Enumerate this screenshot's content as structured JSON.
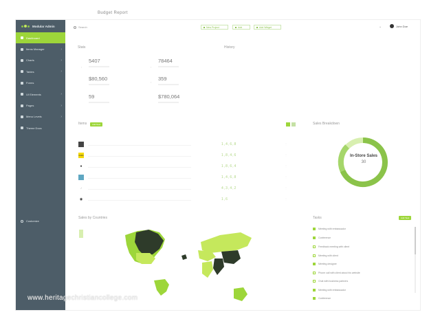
{
  "page": {
    "title": "Modular Admin"
  },
  "header": {
    "top_title": "Budget Report",
    "search_placeholder": "Search",
    "buttons": [
      "New Project",
      "Add",
      "Add Widget"
    ],
    "user_name": "John Doe"
  },
  "sidebar": {
    "brand": "Modular Admin",
    "items": [
      {
        "label": "Dashboard"
      },
      {
        "label": "Items Manager"
      },
      {
        "label": "Charts"
      },
      {
        "label": "Tables"
      },
      {
        "label": "Forms"
      },
      {
        "label": "UI Elements"
      },
      {
        "label": "Pages"
      },
      {
        "label": "Menu Levels"
      },
      {
        "label": "Theme Docs"
      }
    ],
    "footer": "Customize"
  },
  "stats": {
    "title": "Stats",
    "side_title": "History",
    "values": [
      "5407",
      "78464",
      "$80,560",
      "359",
      "59",
      "$780,064"
    ]
  },
  "items": {
    "title": "Items",
    "badge": "Add New",
    "rows": [
      {
        "value": "1,4,6,8"
      },
      {
        "value": "1,8,4,6"
      },
      {
        "value": "1,8,6,4"
      },
      {
        "value": "1,4,6,8"
      },
      {
        "value": "4,3,4,2"
      },
      {
        "value": "1,6"
      }
    ]
  },
  "sales": {
    "title": "Sales Breakdown",
    "center_label": "In-Store Sales",
    "center_value": "30"
  },
  "map": {
    "title": "Sales by Countries"
  },
  "tasks": {
    "title": "Tasks",
    "badge": "Add Task",
    "items": [
      {
        "label": "Meeting with embassador"
      },
      {
        "label": "Conference"
      },
      {
        "label": "Feedback meeting with client"
      },
      {
        "label": "Meeting with client"
      },
      {
        "label": "Meeting designer"
      },
      {
        "label": "Phone call with client about his website"
      },
      {
        "label": "Chat with business partners"
      },
      {
        "label": "Meeting with embassador"
      },
      {
        "label": "Conference"
      }
    ]
  },
  "watermark": "www.heritagechristiancollege.com",
  "colors": {
    "accent": "#9dd63a",
    "sidebar": "#4d5d68",
    "map_dark": "#2e3b2a"
  }
}
